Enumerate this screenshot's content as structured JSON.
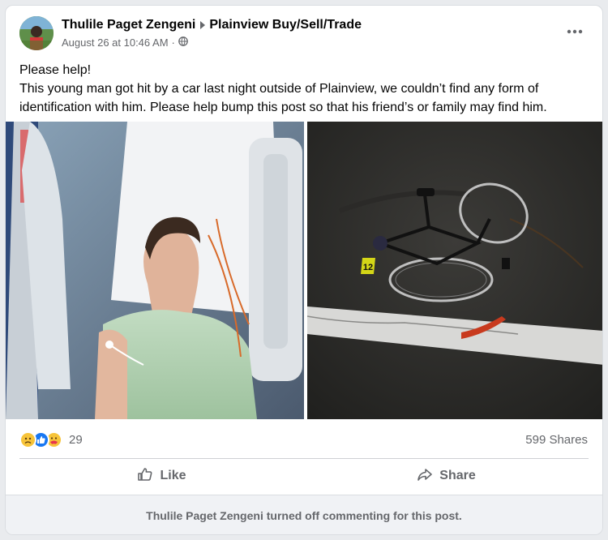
{
  "post": {
    "author": "Thulile Paget Zengeni",
    "group": "Plainview Buy/Sell/Trade",
    "timestamp": "August 26 at 10:46 AM",
    "separator": "·",
    "audience_icon": "globe-icon",
    "text_lines": [
      "Please help!",
      "This young man got hit by a car last night outside of Plainview, we couldn’t find any form of",
      "identification with him. Please help bump this post so that his friend’s or family may find him."
    ]
  },
  "photos": {
    "left_icon": "hospital-patient-photo",
    "right_icon": "bicycle-on-road-photo",
    "evidence_marker": "12"
  },
  "engagement": {
    "reactions": [
      "sad",
      "like",
      "care"
    ],
    "reaction_count": "29",
    "shares": "599 Shares"
  },
  "actions": {
    "like_label": "Like",
    "share_label": "Share"
  },
  "comments": {
    "notice": "Thulile Paget Zengeni turned off commenting for this post."
  },
  "colors": {
    "text": "#050505",
    "secondary": "#65676b",
    "like_blue": "#1877f2",
    "background": "#e9ebee"
  }
}
